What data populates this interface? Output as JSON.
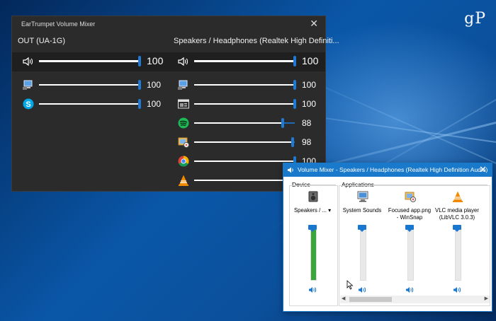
{
  "desktop": {
    "watermark": "gP"
  },
  "eartrumpet": {
    "title": "EarTrumpet Volume Mixer",
    "close_glyph": "✕",
    "devices": [
      {
        "name": "OUT (UA-1G)",
        "master": {
          "icon": "speaker-icon",
          "volume": 100,
          "label": "100"
        },
        "apps": [
          {
            "icon": "system-sounds-icon",
            "volume": 100,
            "label": "100"
          },
          {
            "icon": "skype-icon",
            "volume": 100,
            "label": "100"
          }
        ]
      },
      {
        "name": "Speakers / Headphones (Realtek High Definiti...",
        "master": {
          "icon": "speaker-icon",
          "volume": 100,
          "label": "100"
        },
        "apps": [
          {
            "icon": "system-sounds-icon",
            "volume": 100,
            "label": "100"
          },
          {
            "icon": "app-window-icon",
            "volume": 100,
            "label": "100"
          },
          {
            "icon": "spotify-icon",
            "volume": 88,
            "label": "88"
          },
          {
            "icon": "winsnap-icon",
            "volume": 98,
            "label": "98"
          },
          {
            "icon": "chrome-icon",
            "volume": 100,
            "label": "100"
          },
          {
            "icon": "vlc-icon",
            "volume": 100,
            "label": ""
          }
        ]
      }
    ],
    "colors": {
      "background": "#2b2b2b",
      "accent": "#1e7ad4"
    }
  },
  "volume_mixer": {
    "title": "Volume Mixer - Speakers / Headphones (Realtek High Definition Audio)",
    "close_glyph": "✕",
    "device_group": "Device",
    "applications_group": "Applications",
    "device": {
      "label": "Speakers / ...",
      "dropdown": "▾",
      "icon": "speaker-device-icon",
      "level": 100
    },
    "apps": [
      {
        "label": "System Sounds",
        "icon": "system-sounds-icon",
        "level": 100
      },
      {
        "label": "Focused app.png - WinSnap",
        "icon": "winsnap-icon",
        "level": 100
      },
      {
        "label": "VLC media player (LibVLC 3.0.3)",
        "icon": "vlc-icon",
        "level": 100
      }
    ],
    "colors": {
      "accent": "#1979ca",
      "meter_active": "#3aa53a"
    }
  }
}
